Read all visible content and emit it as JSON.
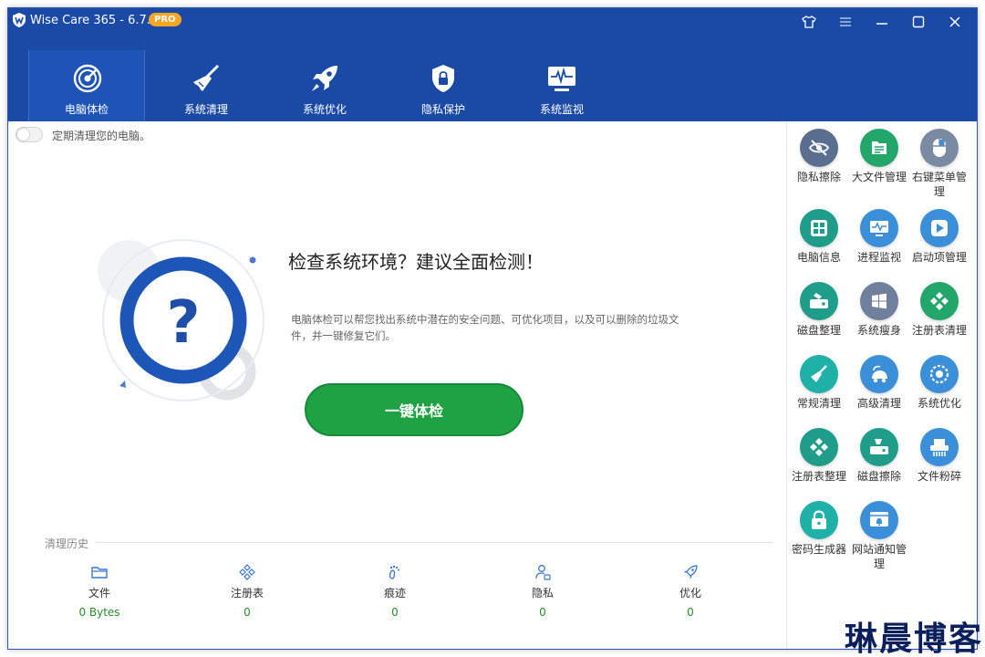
{
  "app": {
    "title": "Wise Care 365 - 6.7.4",
    "badge": "PRO"
  },
  "tabs": [
    {
      "label": "电脑体检",
      "icon": "radar-icon"
    },
    {
      "label": "系统清理",
      "icon": "broom-icon"
    },
    {
      "label": "系统优化",
      "icon": "rocket-icon"
    },
    {
      "label": "隐私保护",
      "icon": "shield-lock-icon"
    },
    {
      "label": "系统监视",
      "icon": "monitor-pulse-icon"
    }
  ],
  "main": {
    "toggle_label": "定期清理您的电脑。",
    "headline": "检查系统环境？建议全面检测！",
    "description": "电脑体检可以帮您找出系统中潜在的安全问题、可优化项目，以及可以删除的垃圾文件，并一键修复它们。",
    "check_button": "一键体检"
  },
  "history": {
    "label": "清理历史",
    "items": [
      {
        "name": "文件",
        "value": "0 Bytes",
        "icon": "folder-icon"
      },
      {
        "name": "注册表",
        "value": "0",
        "icon": "registry-icon"
      },
      {
        "name": "痕迹",
        "value": "0",
        "icon": "footprint-icon"
      },
      {
        "name": "隐私",
        "value": "0",
        "icon": "user-privacy-icon"
      },
      {
        "name": "优化",
        "value": "0",
        "icon": "rocket-small-icon"
      }
    ]
  },
  "sidebar": {
    "tools": [
      {
        "label": "隐私擦除",
        "icon": "eye-off-icon",
        "color": "#5a6f8f"
      },
      {
        "label": "大文件管理",
        "icon": "file-list-icon",
        "color": "#22a66a"
      },
      {
        "label": "右键菜单管理",
        "icon": "mouse-icon",
        "color": "#7a8aa3"
      },
      {
        "label": "电脑信息",
        "icon": "computer-info-icon",
        "color": "#1f9d8a"
      },
      {
        "label": "进程监视",
        "icon": "process-monitor-icon",
        "color": "#3b8fd9"
      },
      {
        "label": "启动项管理",
        "icon": "play-icon",
        "color": "#3b8fd9"
      },
      {
        "label": "磁盘整理",
        "icon": "disk-defrag-icon",
        "color": "#1f9d8a"
      },
      {
        "label": "系统瘦身",
        "icon": "windows-icon",
        "color": "#6f7f9c"
      },
      {
        "label": "注册表清理",
        "icon": "registry-clean-icon",
        "color": "#22a66a"
      },
      {
        "label": "常规清理",
        "icon": "broom-clean-icon",
        "color": "#1fb0a8"
      },
      {
        "label": "高级清理",
        "icon": "vacuum-icon",
        "color": "#3b8fd9"
      },
      {
        "label": "系统优化",
        "icon": "gear-boost-icon",
        "color": "#3b8fd9"
      },
      {
        "label": "注册表整理",
        "icon": "registry-defrag-icon",
        "color": "#1f9d8a"
      },
      {
        "label": "磁盘擦除",
        "icon": "disk-wipe-icon",
        "color": "#1f9d8a"
      },
      {
        "label": "文件粉碎",
        "icon": "shredder-icon",
        "color": "#3b8fd9"
      },
      {
        "label": "密码生成器",
        "icon": "password-lock-icon",
        "color": "#1fb0a8"
      },
      {
        "label": "网站通知管理",
        "icon": "web-bell-icon",
        "color": "#3b8fd9"
      }
    ]
  },
  "watermark": "琳晨博客",
  "colors": {
    "header": "#1b4aa6",
    "accent_green": "#1ea243",
    "history_value": "#2a8a2a"
  }
}
